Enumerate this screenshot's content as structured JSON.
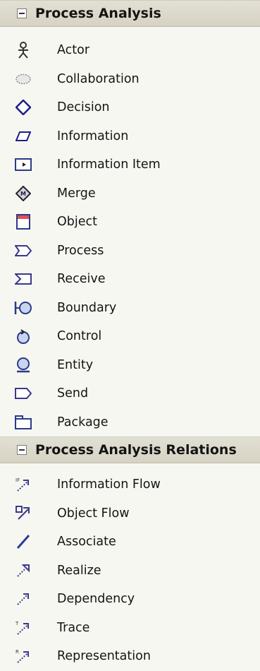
{
  "sections": [
    {
      "title": "Process Analysis",
      "items": [
        {
          "label": "Actor",
          "icon": "actor-icon"
        },
        {
          "label": "Collaboration",
          "icon": "collaboration-icon"
        },
        {
          "label": "Decision",
          "icon": "decision-icon"
        },
        {
          "label": "Information",
          "icon": "information-icon"
        },
        {
          "label": "Information Item",
          "icon": "information-item-icon"
        },
        {
          "label": "Merge",
          "icon": "merge-icon"
        },
        {
          "label": "Object",
          "icon": "object-icon"
        },
        {
          "label": "Process",
          "icon": "process-icon"
        },
        {
          "label": "Receive",
          "icon": "receive-icon"
        },
        {
          "label": "Boundary",
          "icon": "boundary-icon"
        },
        {
          "label": "Control",
          "icon": "control-icon"
        },
        {
          "label": "Entity",
          "icon": "entity-icon"
        },
        {
          "label": "Send",
          "icon": "send-icon"
        },
        {
          "label": "Package",
          "icon": "package-icon"
        }
      ]
    },
    {
      "title": "Process Analysis Relations",
      "items": [
        {
          "label": "Information Flow",
          "icon": "information-flow-icon"
        },
        {
          "label": "Object Flow",
          "icon": "object-flow-icon"
        },
        {
          "label": "Associate",
          "icon": "associate-icon"
        },
        {
          "label": "Realize",
          "icon": "realize-icon"
        },
        {
          "label": "Dependency",
          "icon": "dependency-icon"
        },
        {
          "label": "Trace",
          "icon": "trace-icon"
        },
        {
          "label": "Representation",
          "icon": "representation-icon"
        }
      ]
    }
  ]
}
